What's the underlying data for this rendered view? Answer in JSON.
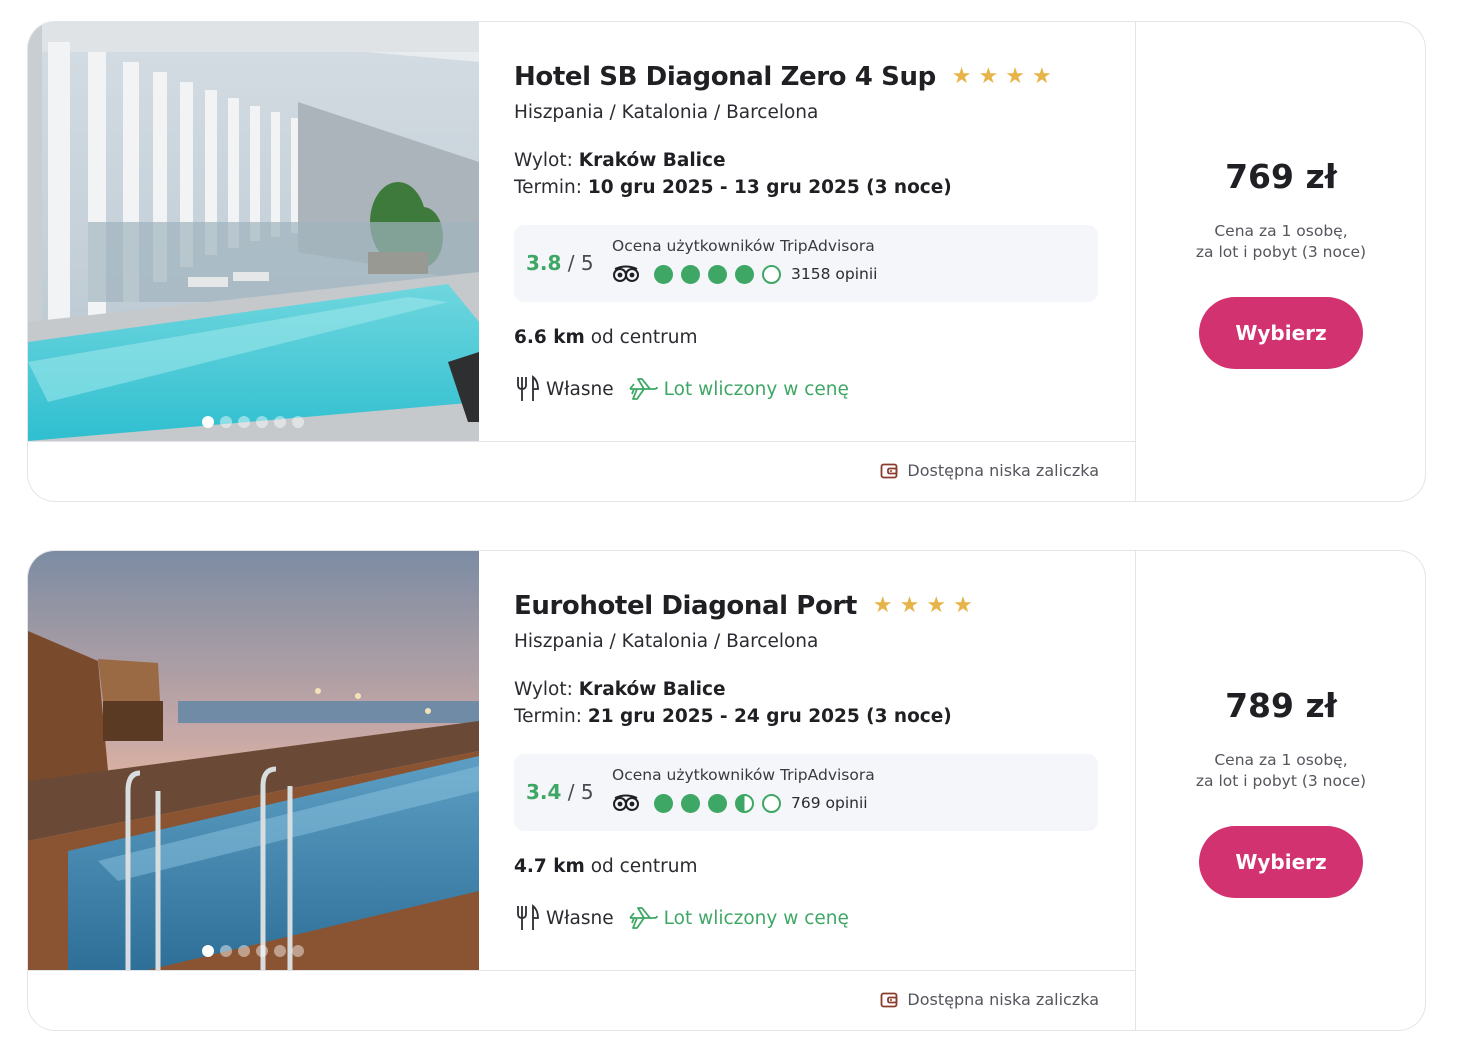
{
  "offers": [
    {
      "name": "Hotel SB Diagonal Zero 4 Sup",
      "stars": 4,
      "location": "Hiszpania / Katalonia / Barcelona",
      "departure_label": "Wylot:",
      "departure": "Kraków Balice",
      "term_label": "Termin:",
      "term": "10 gru 2025 - 13 gru 2025 (3 noce)",
      "rating": {
        "score": "3.8",
        "out_of": "/ 5",
        "label": "Ocena użytkowników TripAdvisora",
        "circles": [
          "full",
          "full",
          "full",
          "full",
          "empty"
        ],
        "count": "3158 opinii"
      },
      "distance_value": "6.6 km",
      "distance_text": "od centrum",
      "meal": "Własne",
      "flight_included": "Lot wliczony w cenę",
      "deposit": "Dostępna niska zaliczka",
      "price": "769 zł",
      "price_note_1": "Cena za 1 osobę,",
      "price_note_2": "za lot i pobyt (3 noce)",
      "button": "Wybierz",
      "gallery_count": 6,
      "gallery_active": 0
    },
    {
      "name": "Eurohotel Diagonal Port",
      "stars": 4,
      "location": "Hiszpania / Katalonia / Barcelona",
      "departure_label": "Wylot:",
      "departure": "Kraków Balice",
      "term_label": "Termin:",
      "term": "21 gru 2025 - 24 gru 2025 (3 noce)",
      "rating": {
        "score": "3.4",
        "out_of": "/ 5",
        "label": "Ocena użytkowników TripAdvisora",
        "circles": [
          "full",
          "full",
          "full",
          "half",
          "empty"
        ],
        "count": "769 opinii"
      },
      "distance_value": "4.7 km",
      "distance_text": "od centrum",
      "meal": "Własne",
      "flight_included": "Lot wliczony w cenę",
      "deposit": "Dostępna niska zaliczka",
      "price": "789 zł",
      "price_note_1": "Cena za 1 osobę,",
      "price_note_2": "za lot i pobyt (3 noce)",
      "button": "Wybierz",
      "gallery_count": 6,
      "gallery_active": 0
    }
  ],
  "colors": {
    "accent_button": "#d2326f",
    "rating_green": "#3fa765",
    "star_gold": "#e7b449"
  },
  "icons": {
    "star": "star-icon",
    "tripadvisor": "tripadvisor-owl-icon",
    "meal": "fork-knife-icon",
    "flight": "airplane-icon",
    "deposit": "wallet-icon"
  }
}
